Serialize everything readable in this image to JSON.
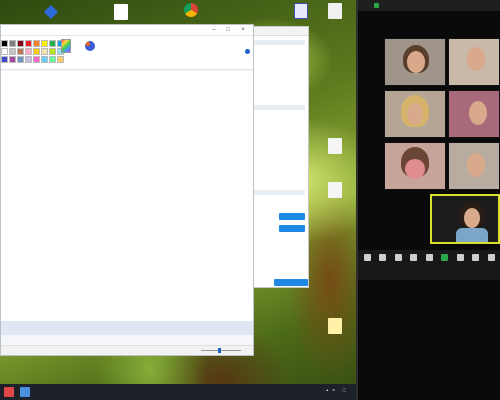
{
  "desktop": {
    "icons": [
      {
        "name": "blue-app",
        "label": "",
        "color": "#2b6ad8"
      },
      {
        "name": "document",
        "label": "",
        "color": "#ffffff"
      },
      {
        "name": "chrome",
        "label": "",
        "color": "#db4437"
      },
      {
        "name": "file-app",
        "label": "",
        "color": "#e8e8ff"
      },
      {
        "name": "folder-1",
        "label": "",
        "color": "#f0f0f0"
      },
      {
        "name": "folder-2",
        "label": "",
        "color": "#f5f5f5"
      },
      {
        "name": "folder-3",
        "label": "",
        "color": "#f5f5f5"
      },
      {
        "name": "folder-4",
        "label": "",
        "color": "#fff2a8"
      }
    ]
  },
  "paint": {
    "title": "",
    "palette_label": "",
    "palette_colors": [
      "#000000",
      "#7f7f7f",
      "#880015",
      "#ed1c24",
      "#ff7f27",
      "#fff200",
      "#22b14c",
      "#00a2e8",
      "#ffffff",
      "#c3c3c3",
      "#b97a57",
      "#ffaec9",
      "#ffc90e",
      "#efe4b0",
      "#b5e61d",
      "#99d9ea",
      "#3f48cc",
      "#a349a4",
      "#7092be",
      "#c8bfe7",
      "#ff66cc",
      "#66ccff",
      "#66ff99",
      "#ffcc66"
    ],
    "edit_colors_label": "",
    "paint3d_label": "",
    "status": {
      "zoom": ""
    }
  },
  "secondary_window": {
    "buttons": [
      "",
      ""
    ],
    "colors": {
      "accent": "#1e88e5"
    }
  },
  "taskbar": {
    "clock_time": "",
    "clock_date": ""
  },
  "zoom_meeting": {
    "title": "",
    "participants": [
      {
        "name": ""
      },
      {
        "name": ""
      },
      {
        "name": ""
      },
      {
        "name": ""
      },
      {
        "name": ""
      },
      {
        "name": ""
      },
      {
        "name": ""
      }
    ],
    "toolbar": [
      {
        "icon": "mic-icon",
        "label": ""
      },
      {
        "icon": "video-icon",
        "label": ""
      },
      {
        "icon": "security-icon",
        "label": ""
      },
      {
        "icon": "participants-icon",
        "label": ""
      },
      {
        "icon": "chat-icon",
        "label": ""
      },
      {
        "icon": "share-icon",
        "label": ""
      },
      {
        "icon": "record-icon",
        "label": ""
      },
      {
        "icon": "reactions-icon",
        "label": ""
      },
      {
        "icon": "more-icon",
        "label": ""
      }
    ],
    "colors": {
      "share": "#2ba84a",
      "background": "#0a0a0a"
    }
  }
}
